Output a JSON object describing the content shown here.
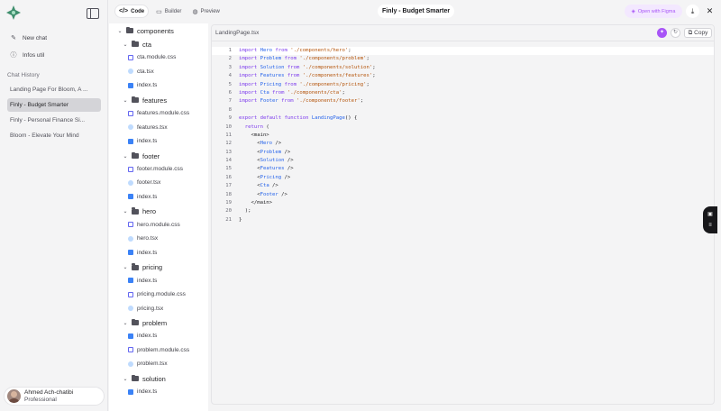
{
  "sidebar": {
    "new_chat": "New chat",
    "infos_util": "Infos util",
    "chat_history_label": "Chat History",
    "history": [
      {
        "label": "Landing Page For Bloom, A ..."
      },
      {
        "label": "Finly - Budget Smarter",
        "active": true
      },
      {
        "label": "Finly - Personal Finance Si..."
      },
      {
        "label": "Bloom - Elevate Your Mind"
      }
    ],
    "user": {
      "name": "Ahmed Ach-chatibi",
      "plan": "Professional"
    }
  },
  "topbar": {
    "tabs": [
      {
        "label": "Code",
        "icon": "code-icon",
        "active": true
      },
      {
        "label": "Builder",
        "icon": "builder-icon"
      },
      {
        "label": "Preview",
        "icon": "globe-icon"
      }
    ],
    "project_title": "Finly - Budget Smarter",
    "figma_button": "Open with Figma"
  },
  "tree": [
    {
      "type": "folder",
      "label": "components",
      "depth": 0
    },
    {
      "type": "folder",
      "label": "cta",
      "depth": 1
    },
    {
      "type": "css",
      "label": "cta.module.css",
      "depth": 2
    },
    {
      "type": "tsx",
      "label": "cta.tsx",
      "depth": 2
    },
    {
      "type": "ts",
      "label": "index.ts",
      "depth": 2
    },
    {
      "type": "folder",
      "label": "features",
      "depth": 1
    },
    {
      "type": "css",
      "label": "features.module.css",
      "depth": 2
    },
    {
      "type": "tsx",
      "label": "features.tsx",
      "depth": 2
    },
    {
      "type": "ts",
      "label": "index.ts",
      "depth": 2
    },
    {
      "type": "folder",
      "label": "footer",
      "depth": 1
    },
    {
      "type": "css",
      "label": "footer.module.css",
      "depth": 2
    },
    {
      "type": "tsx",
      "label": "footer.tsx",
      "depth": 2
    },
    {
      "type": "ts",
      "label": "index.ts",
      "depth": 2
    },
    {
      "type": "folder",
      "label": "hero",
      "depth": 1
    },
    {
      "type": "css",
      "label": "hero.module.css",
      "depth": 2
    },
    {
      "type": "tsx",
      "label": "hero.tsx",
      "depth": 2
    },
    {
      "type": "ts",
      "label": "index.ts",
      "depth": 2
    },
    {
      "type": "folder",
      "label": "pricing",
      "depth": 1
    },
    {
      "type": "ts",
      "label": "index.ts",
      "depth": 2
    },
    {
      "type": "css",
      "label": "pricing.module.css",
      "depth": 2
    },
    {
      "type": "tsx",
      "label": "pricing.tsx",
      "depth": 2
    },
    {
      "type": "folder",
      "label": "problem",
      "depth": 1
    },
    {
      "type": "ts",
      "label": "index.ts",
      "depth": 2
    },
    {
      "type": "css",
      "label": "problem.module.css",
      "depth": 2
    },
    {
      "type": "tsx",
      "label": "problem.tsx",
      "depth": 2
    },
    {
      "type": "folder",
      "label": "solution",
      "depth": 1
    },
    {
      "type": "ts",
      "label": "index.ts",
      "depth": 2
    }
  ],
  "editor": {
    "file_name": "LandingPage.tsx",
    "copy_label": "Copy",
    "active_line": 1,
    "lines": [
      [
        [
          "kw",
          "import "
        ],
        [
          "id",
          "Hero"
        ],
        [
          "kw",
          " from "
        ],
        [
          "str",
          "'./components/hero'"
        ],
        [
          "",
          "; "
        ]
      ],
      [
        [
          "kw",
          "import "
        ],
        [
          "id",
          "Problem"
        ],
        [
          "kw",
          " from "
        ],
        [
          "str",
          "'./components/problem'"
        ],
        [
          "",
          ";"
        ]
      ],
      [
        [
          "kw",
          "import "
        ],
        [
          "id",
          "Solution"
        ],
        [
          "kw",
          " from "
        ],
        [
          "str",
          "'./components/solution'"
        ],
        [
          "",
          ";"
        ]
      ],
      [
        [
          "kw",
          "import "
        ],
        [
          "id",
          "Features"
        ],
        [
          "kw",
          " from "
        ],
        [
          "str",
          "'./components/features'"
        ],
        [
          "",
          ";"
        ]
      ],
      [
        [
          "kw",
          "import "
        ],
        [
          "id",
          "Pricing"
        ],
        [
          "kw",
          " from "
        ],
        [
          "str",
          "'./components/pricing'"
        ],
        [
          "",
          ";"
        ]
      ],
      [
        [
          "kw",
          "import "
        ],
        [
          "id",
          "Cta"
        ],
        [
          "kw",
          " from "
        ],
        [
          "str",
          "'./components/cta'"
        ],
        [
          "",
          ";"
        ]
      ],
      [
        [
          "kw",
          "import "
        ],
        [
          "id",
          "Footer"
        ],
        [
          "kw",
          " from "
        ],
        [
          "str",
          "'./components/footer'"
        ],
        [
          "",
          ";"
        ]
      ],
      [],
      [
        [
          "kw",
          "export default function "
        ],
        [
          "id",
          "LandingPage"
        ],
        [
          "",
          "() {"
        ]
      ],
      [
        [
          "",
          "  "
        ],
        [
          "kw",
          "return"
        ],
        [
          "",
          " ("
        ]
      ],
      [
        [
          "",
          "    <main>"
        ]
      ],
      [
        [
          "",
          "      <"
        ],
        [
          "tag",
          "Hero"
        ],
        [
          "",
          " />"
        ]
      ],
      [
        [
          "",
          "      <"
        ],
        [
          "tag",
          "Problem"
        ],
        [
          "",
          " />"
        ]
      ],
      [
        [
          "",
          "      <"
        ],
        [
          "tag",
          "Solution"
        ],
        [
          "",
          " />"
        ]
      ],
      [
        [
          "",
          "      <"
        ],
        [
          "tag",
          "Features"
        ],
        [
          "",
          " />"
        ]
      ],
      [
        [
          "",
          "      <"
        ],
        [
          "tag",
          "Pricing"
        ],
        [
          "",
          " />"
        ]
      ],
      [
        [
          "",
          "      <"
        ],
        [
          "tag",
          "Cta"
        ],
        [
          "",
          " />"
        ]
      ],
      [
        [
          "",
          "      <"
        ],
        [
          "tag",
          "Footer"
        ],
        [
          "",
          " />"
        ]
      ],
      [
        [
          "",
          "    </main>"
        ]
      ],
      [
        [
          "",
          "  );"
        ]
      ],
      [
        [
          "",
          "}"
        ]
      ]
    ]
  },
  "colors": {
    "accent": "#a855f7",
    "keyword": "#7c3aed",
    "identifier": "#2563eb",
    "string": "#b45309"
  }
}
